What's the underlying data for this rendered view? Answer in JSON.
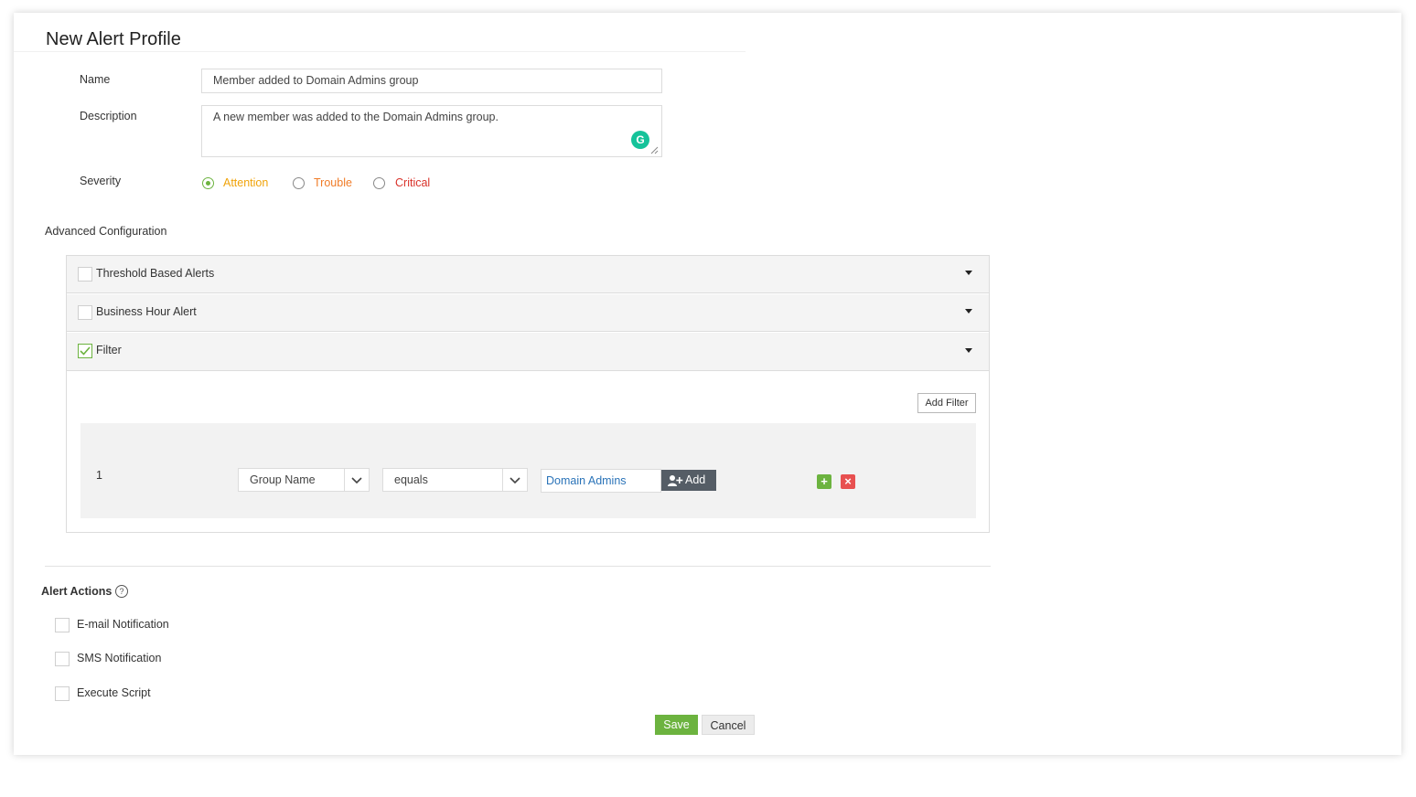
{
  "page": {
    "title": "New Alert Profile"
  },
  "form": {
    "name_label": "Name",
    "name_value": "Member added to Domain Admins group",
    "description_label": "Description",
    "description_value": "A new member was added to the Domain Admins group.",
    "severity_label": "Severity",
    "severity_options": [
      {
        "label": "Attention",
        "color": "#f0a30a",
        "selected": true
      },
      {
        "label": "Trouble",
        "color": "#f07c28",
        "selected": false
      },
      {
        "label": "Critical",
        "color": "#d9322a",
        "selected": false
      }
    ]
  },
  "advanced": {
    "title": "Advanced Configuration",
    "sections": [
      {
        "label": "Threshold Based Alerts",
        "checked": false
      },
      {
        "label": "Business Hour Alert",
        "checked": false
      },
      {
        "label": "Filter",
        "checked": true
      }
    ],
    "add_filter_label": "Add Filter",
    "filter_row": {
      "index": "1",
      "field": "Group Name",
      "operator": "equals",
      "value": "Domain Admins",
      "add_label": "Add",
      "plus_symbol": "+",
      "remove_symbol": "×"
    }
  },
  "alert_actions": {
    "title": "Alert Actions",
    "help_symbol": "?",
    "items": [
      {
        "label": "E-mail Notification",
        "checked": false
      },
      {
        "label": "SMS Notification",
        "checked": false
      },
      {
        "label": "Execute Script",
        "checked": false
      }
    ]
  },
  "buttons": {
    "save": "Save",
    "cancel": "Cancel"
  },
  "colors": {
    "accent_green": "#6cb33f",
    "danger_red": "#e85050",
    "dark_button": "#555d66",
    "link_blue": "#2a73b8"
  }
}
